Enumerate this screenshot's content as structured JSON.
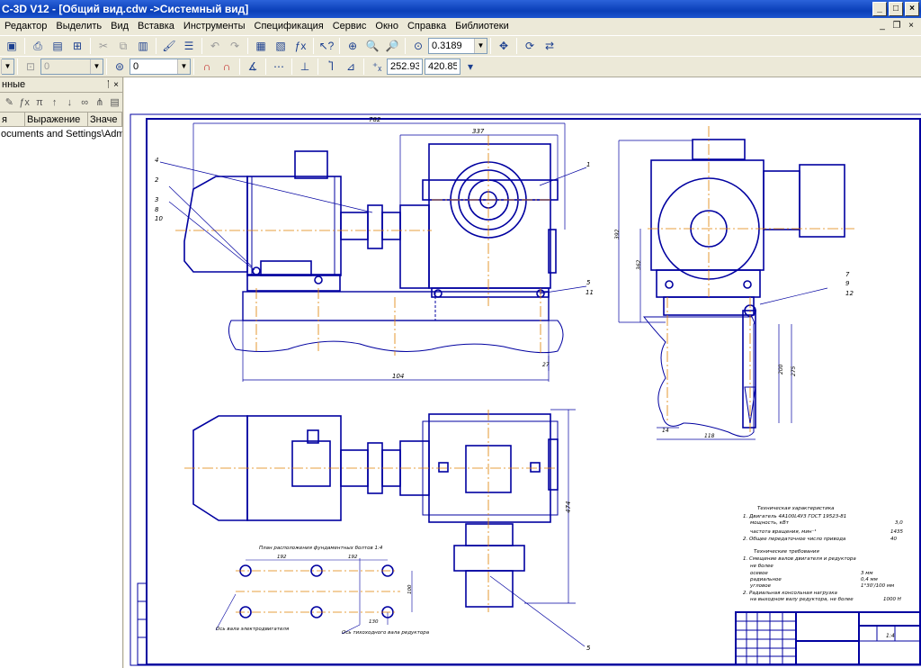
{
  "window": {
    "title": "С-3D V12 - [Общий вид.cdw ->Системный вид]"
  },
  "menu": [
    "Редактор",
    "Выделить",
    "Вид",
    "Вставка",
    "Инструменты",
    "Спецификация",
    "Сервис",
    "Окно",
    "Справка",
    "Библиотеки"
  ],
  "toolbar1": {
    "zoom_value": "0.3189"
  },
  "toolbar2": {
    "style_value": "0",
    "layer_value": "0",
    "coord_x": "252.937",
    "coord_y": "420.858"
  },
  "panel": {
    "title": "нные",
    "columns": [
      "я",
      "Выражение",
      "Значе"
    ],
    "row_path": "ocuments and Settings\\Admin\\Lo"
  },
  "drawing": {
    "dims": {
      "d782": "782",
      "d337": "337",
      "d392": "392",
      "d362": "362",
      "d104": "104",
      "d27": "27",
      "d14": "14",
      "d118": "118",
      "d200": "200",
      "d275": "275",
      "d474": "474",
      "d192a": "192",
      "d192b": "192",
      "d130": "130",
      "d100": "100"
    },
    "callouts": {
      "c1": "1",
      "c2": "2",
      "c3": "3",
      "c4": "4",
      "c5": "5",
      "c5b": "5",
      "c7": "7",
      "c8": "8",
      "c9": "9",
      "c10": "10",
      "c11": "11",
      "c12": "12"
    },
    "notes": {
      "hole_plan_title": "План расположения фундаментных болтов 1:4",
      "axis_motor": "Ось вала электродвигателя",
      "axis_reducer": "Ось тихоходного вала редуктора",
      "tech_title": "Техническая характеристика",
      "tech_1": "1. Двигатель 4А100L4У3 ГОСТ 19523-81",
      "tech_1a": "мощность, кВт",
      "tech_1a_val": "3,0",
      "tech_1b": "частота вращения, мин⁻¹",
      "tech_1b_val": "1435",
      "tech_2": "2. Общее передаточное число привода",
      "tech_2_val": "40",
      "req_title": "Технические требования",
      "req_1": "1. Смещение валов двигателя и редуктора",
      "req_1a": "не более",
      "req_1b": "осевое",
      "req_1b_val": "3 мм",
      "req_1c": "радиальное",
      "req_1c_val": "0,4 мм",
      "req_1d": "угловое",
      "req_1d_val": "1°30'/100 мм",
      "req_2": "2. Радиальная консольная нагрузка",
      "req_2a": "на выходном валу редуктора, не более",
      "req_2a_val": "1000 Н",
      "sheet": "1:4"
    }
  }
}
